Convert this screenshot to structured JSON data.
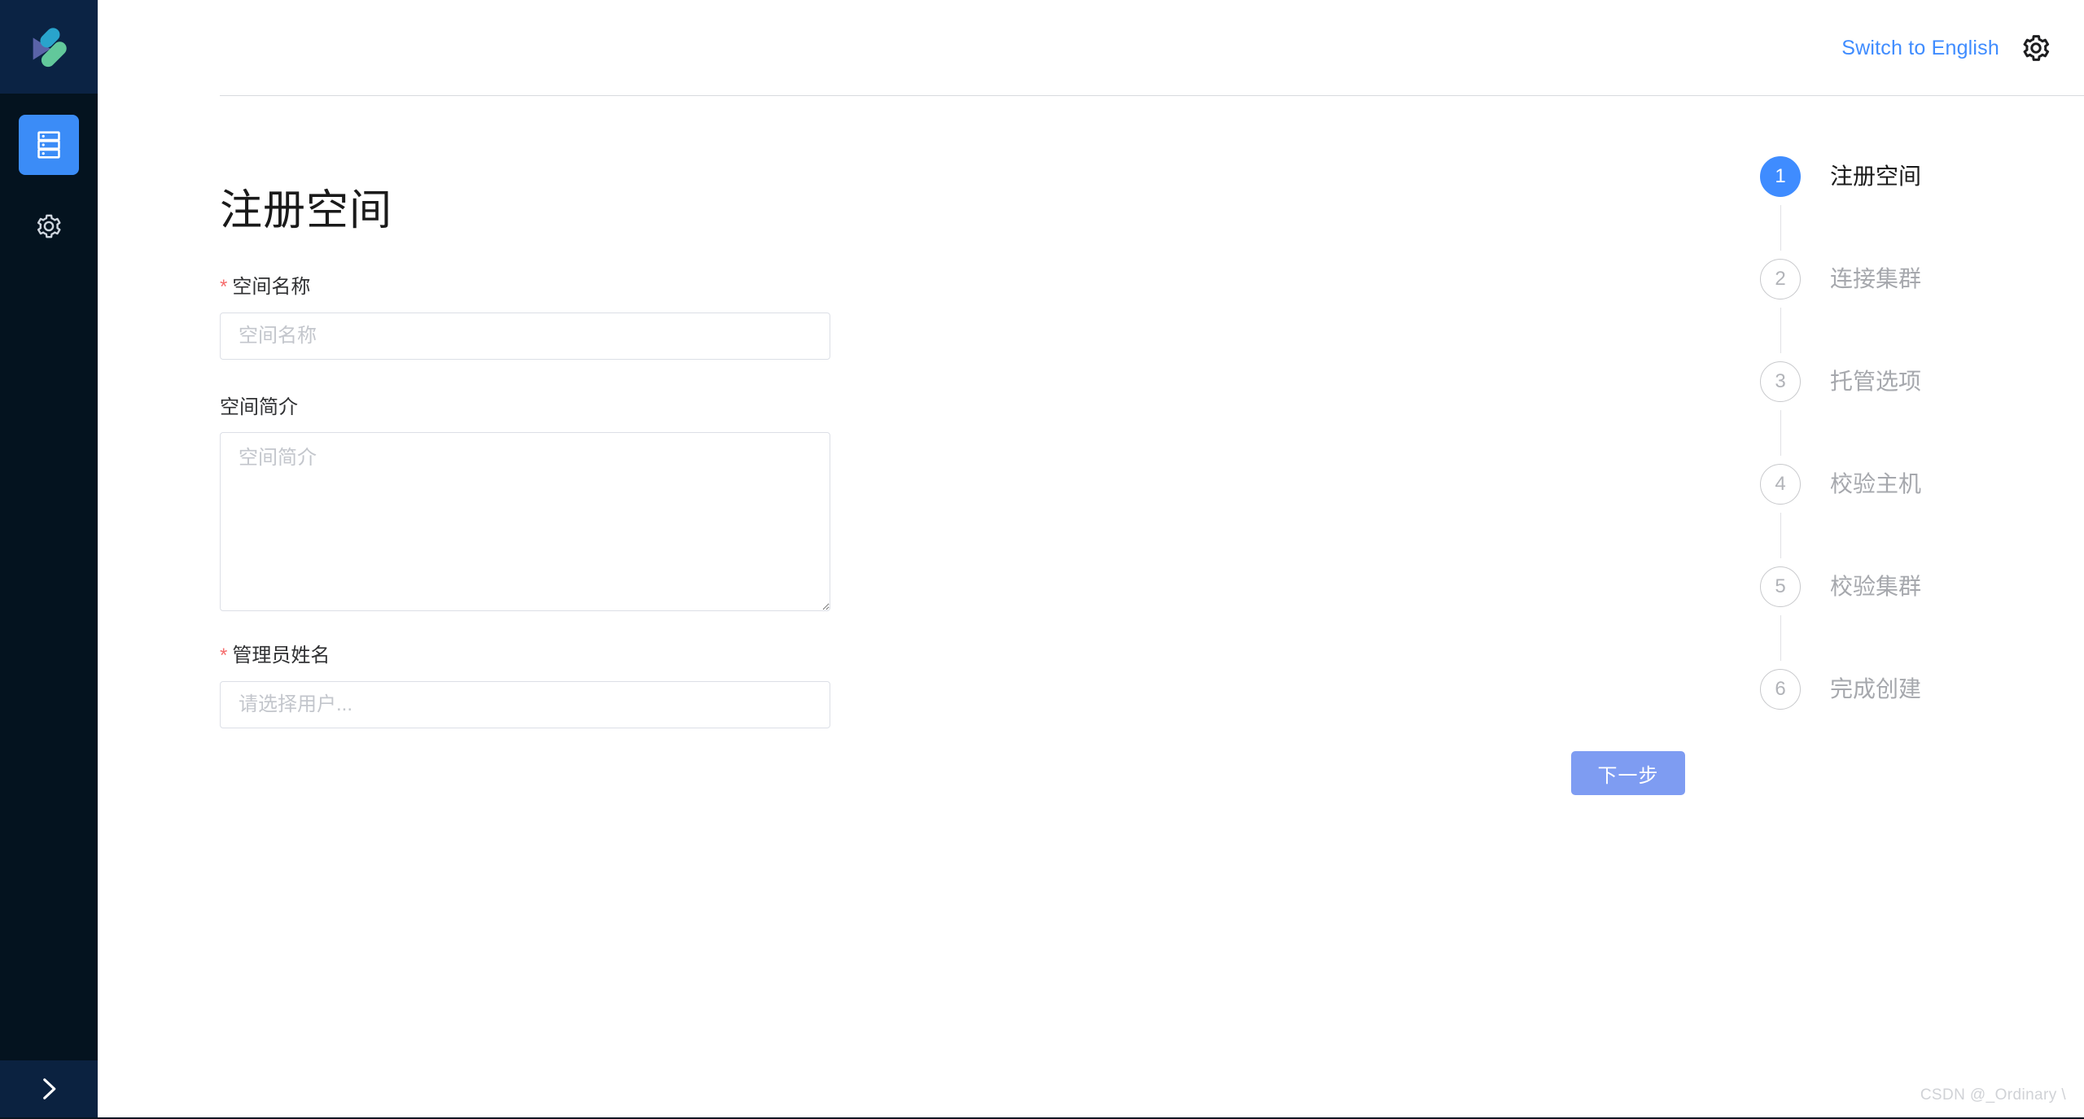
{
  "sidebar": {
    "logo_icon": "brand-logo-icon",
    "items": [
      {
        "id": "spaces",
        "icon": "server-rack-icon",
        "active": true
      },
      {
        "id": "settings",
        "icon": "gear-icon",
        "active": false
      }
    ],
    "expand": {
      "icon": "chevron-right-icon",
      "label": ">"
    }
  },
  "topbar": {
    "language_switch_label": "Switch to English",
    "settings_icon": "gear-icon"
  },
  "main": {
    "page_title": "注册空间",
    "form": {
      "space_name": {
        "label": "空间名称",
        "required_marker": "*",
        "required": true,
        "placeholder": "空间名称",
        "value": ""
      },
      "space_desc": {
        "label": "空间简介",
        "required": false,
        "placeholder": "空间简介",
        "value": ""
      },
      "admin_name": {
        "label": "管理员姓名",
        "required_marker": "*",
        "required": true,
        "placeholder": "请选择用户...",
        "value": ""
      }
    },
    "next_button_label": "下一步"
  },
  "stepper": {
    "current": 1,
    "steps": [
      {
        "number": "1",
        "label": "注册空间",
        "active": true
      },
      {
        "number": "2",
        "label": "连接集群",
        "active": false
      },
      {
        "number": "3",
        "label": "托管选项",
        "active": false
      },
      {
        "number": "4",
        "label": "校验主机",
        "active": false
      },
      {
        "number": "5",
        "label": "校验集群",
        "active": false
      },
      {
        "number": "6",
        "label": "完成创建",
        "active": false
      }
    ]
  },
  "watermark": "CSDN @_Ordinary \\",
  "colors": {
    "sidebar_bg": "#04131f",
    "sidebar_logo_bg": "#0b2344",
    "accent_blue": "#3f8cff",
    "active_rail_blue": "#3b8cf7",
    "next_button_blue": "#7e9cf2",
    "required_red": "#f56c6c",
    "border_grey": "#dcdfe6",
    "placeholder_grey": "#c3c6cc",
    "step_inactive_grey": "#a6a8ad",
    "logo_teal": "#29a4cc",
    "logo_green": "#62c89b",
    "logo_purple": "#5a63a8"
  }
}
